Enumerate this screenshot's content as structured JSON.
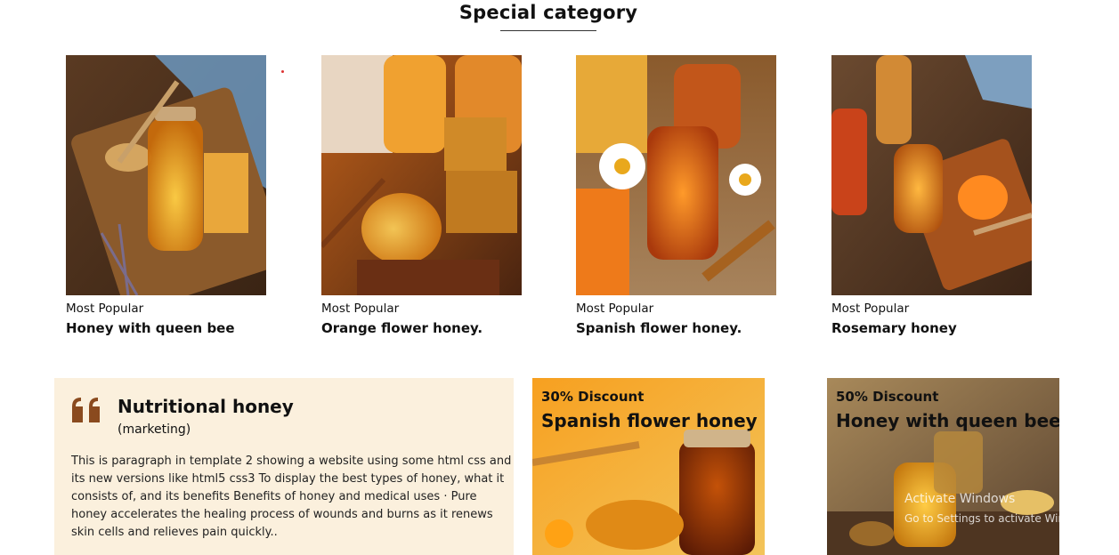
{
  "section": {
    "title": "Special category"
  },
  "products": [
    {
      "tag": "Most Popular",
      "name": "Honey with queen bee"
    },
    {
      "tag": "Most Popular",
      "name": "Orange flower honey."
    },
    {
      "tag": "Most Popular",
      "name": "Spanish flower honey."
    },
    {
      "tag": "Most Popular",
      "name": "Rosemary honey"
    }
  ],
  "info_panel": {
    "title": "Nutritional honey",
    "subtitle": "(marketing)",
    "text": "This is paragraph in template 2 showing a website using some html css and its new versions like html5 css3 To display the best types of honey, what it consists of, and its benefits Benefits of honey and medical uses · Pure honey accelerates the healing process of wounds and burns as it renews skin cells and relieves pain quickly..",
    "quote_icon": "quote-icon",
    "quote_color": "#8a4a1e"
  },
  "promos": [
    {
      "discount": "30% Discount",
      "name": "Spanish flower honey"
    },
    {
      "discount": "50% Discount",
      "name": "Honey with queen bee"
    }
  ],
  "watermark": {
    "line1": "Activate Windows",
    "line2": "Go to Settings to activate Windows."
  }
}
